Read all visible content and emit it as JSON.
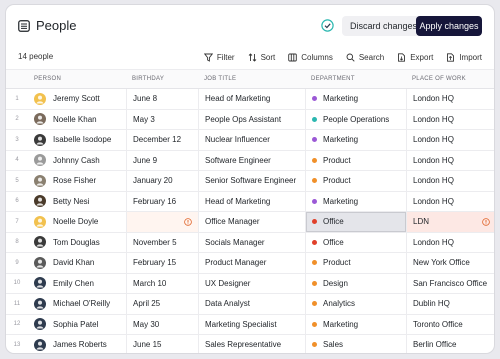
{
  "header": {
    "title": "People",
    "discard_label": "Discard changes",
    "apply_label": "Apply changes"
  },
  "toolbar": {
    "count": "14 people",
    "filter": "Filter",
    "sort": "Sort",
    "columns": "Columns",
    "search": "Search",
    "export": "Export",
    "import": "Import"
  },
  "columns": {
    "person": "PERSON",
    "birthday": "BIRTHDAY",
    "job": "JOB TITLE",
    "department": "DEPARTMENT",
    "place": "PLACE OF WORK"
  },
  "rows": [
    {
      "num": "1",
      "name": "Jeremy Scott",
      "birthday": "June 8",
      "job": "Head of Marketing",
      "dept": "Marketing",
      "dept_color": "#9b59d6",
      "place": "London HQ",
      "avatar_color": "#f2c14e"
    },
    {
      "num": "2",
      "name": "Noelle Khan",
      "birthday": "May 3",
      "job": "People Ops Assistant",
      "dept": "People Operations",
      "dept_color": "#2bb7b0",
      "place": "London HQ",
      "avatar_color": "#7a6a5c"
    },
    {
      "num": "3",
      "name": "Isabelle Isodope",
      "birthday": "December 12",
      "job": "Nuclear Influencer",
      "dept": "Marketing",
      "dept_color": "#9b59d6",
      "place": "London HQ",
      "avatar_color": "#3a3a3a"
    },
    {
      "num": "4",
      "name": "Johnny Cash",
      "birthday": "June 9",
      "job": "Software Engineer",
      "dept": "Product",
      "dept_color": "#f0902a",
      "place": "London HQ",
      "avatar_color": "#9a9a9a"
    },
    {
      "num": "5",
      "name": "Rose Fisher",
      "birthday": "January 20",
      "job": "Senior Software Engineer",
      "dept": "Product",
      "dept_color": "#f0902a",
      "place": "London HQ",
      "avatar_color": "#8a8070"
    },
    {
      "num": "6",
      "name": "Betty Nesi",
      "birthday": "February 16",
      "job": "Head of Marketing",
      "dept": "Marketing",
      "dept_color": "#9b59d6",
      "place": "London HQ",
      "avatar_color": "#4a3a2a"
    },
    {
      "num": "7",
      "name": "Noelle Doyle",
      "birthday": "",
      "job": "Office Manager",
      "dept": "Office",
      "dept_color": "#e0402a",
      "place": "LDN",
      "avatar_color": "#f2c14e",
      "error": true
    },
    {
      "num": "8",
      "name": "Tom Douglas",
      "birthday": "November 5",
      "job": "Socials Manager",
      "dept": "Office",
      "dept_color": "#e0402a",
      "place": "London HQ",
      "avatar_color": "#3a3a3a"
    },
    {
      "num": "9",
      "name": "David Khan",
      "birthday": "February 15",
      "job": "Product Manager",
      "dept": "Product",
      "dept_color": "#f0902a",
      "place": "New York Office",
      "avatar_color": "#5a5a5a"
    },
    {
      "num": "10",
      "name": "Emily Chen",
      "birthday": "March 10",
      "job": "UX Designer",
      "dept": "Design",
      "dept_color": "#f0902a",
      "place": "San Francisco Office",
      "avatar_color": "#2e3b4e"
    },
    {
      "num": "11",
      "name": "Michael O'Reilly",
      "birthday": "April 25",
      "job": "Data Analyst",
      "dept": "Analytics",
      "dept_color": "#f0902a",
      "place": "Dublin HQ",
      "avatar_color": "#2e3b4e"
    },
    {
      "num": "12",
      "name": "Sophia Patel",
      "birthday": "May 30",
      "job": "Marketing Specialist",
      "dept": "Marketing",
      "dept_color": "#f0902a",
      "place": "Toronto Office",
      "avatar_color": "#2e3b4e"
    },
    {
      "num": "13",
      "name": "James Roberts",
      "birthday": "June 15",
      "job": "Sales Representative",
      "dept": "Sales",
      "dept_color": "#f0902a",
      "place": "Berlin Office",
      "avatar_color": "#2e3b4e"
    }
  ]
}
